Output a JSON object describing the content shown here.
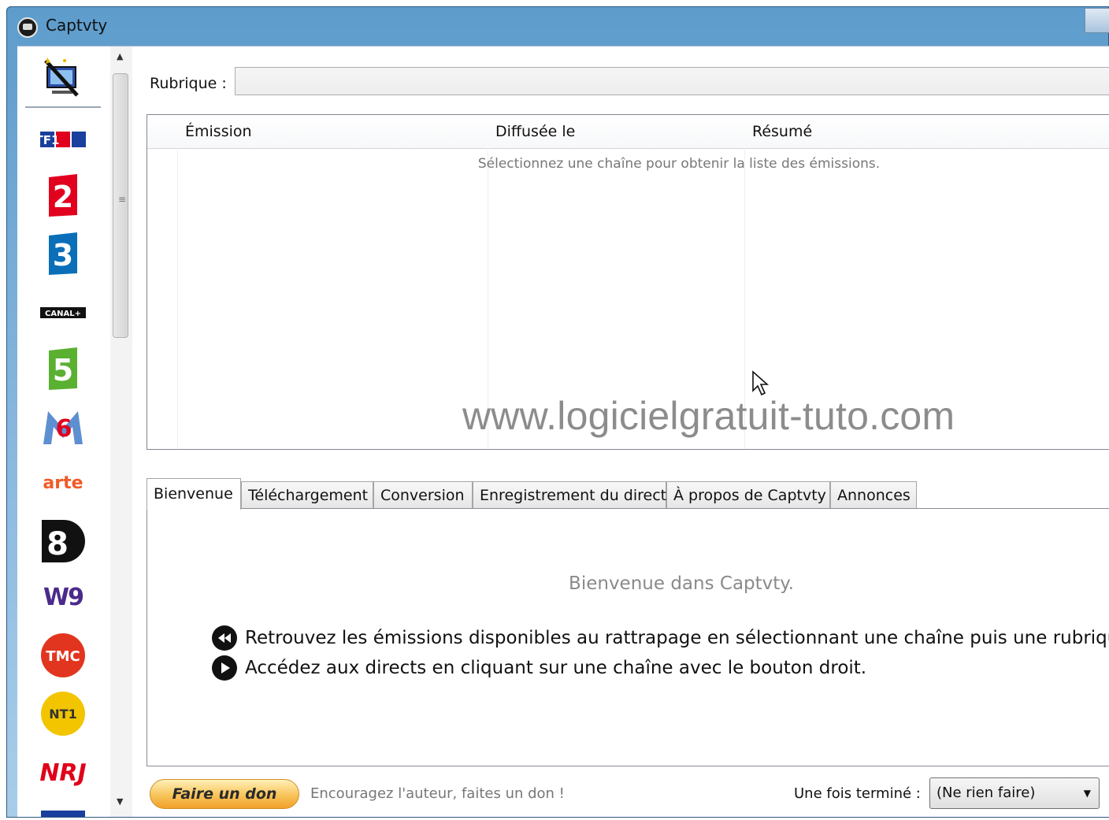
{
  "window": {
    "title": "Captvty"
  },
  "channels": [
    {
      "id": "tools",
      "label": ""
    },
    {
      "id": "tf1",
      "label": "TF1"
    },
    {
      "id": "france2",
      "label": "2"
    },
    {
      "id": "france3",
      "label": "3"
    },
    {
      "id": "canalplus",
      "label": "CANAL+"
    },
    {
      "id": "france5",
      "label": "5"
    },
    {
      "id": "m6",
      "label": "6"
    },
    {
      "id": "arte",
      "label": "arte"
    },
    {
      "id": "d8",
      "label": "8"
    },
    {
      "id": "w9",
      "label": "W9"
    },
    {
      "id": "tmc",
      "label": "TMC"
    },
    {
      "id": "nt1",
      "label": "NT1"
    },
    {
      "id": "nrj12",
      "label": "NRJ"
    }
  ],
  "main": {
    "rubrique_label": "Rubrique :",
    "columns": [
      "Émission",
      "Diffusée le",
      "Résumé"
    ],
    "empty_message": "Sélectionnez une chaîne pour obtenir la liste des émissions.",
    "watermark": "www.logicielgratuit-tuto.com"
  },
  "tabs": [
    {
      "label": "Bienvenue",
      "active": true
    },
    {
      "label": "Téléchargement",
      "active": false
    },
    {
      "label": "Conversion",
      "active": false
    },
    {
      "label": "Enregistrement du direct",
      "active": false
    },
    {
      "label": "À propos de Captvty",
      "active": false
    },
    {
      "label": "Annonces",
      "active": false
    }
  ],
  "welcome": {
    "title": "Bienvenue dans Captvty.",
    "lines": [
      {
        "icon": "rewind-icon",
        "text": "Retrouvez les émissions disponibles au rattrapage en sélectionnant une chaîne puis une rubrique."
      },
      {
        "icon": "play-icon",
        "text": "Accédez aux directs en cliquant sur une chaîne avec le bouton droit."
      }
    ]
  },
  "footer": {
    "donate_label": "Faire un don",
    "donate_text": "Encouragez l'auteur, faites un don !",
    "finish_label": "Une fois terminé :",
    "finish_value": "(Ne rien faire)"
  },
  "colors": {
    "title_bar": "#5d9ccc",
    "donate_button": "#f8c35a",
    "tf1_blue": "#1a3f9c",
    "france2_red": "#e1001e",
    "france3_blue": "#0a6fb8",
    "france5_green": "#5ab031",
    "arte_orange": "#f05a28",
    "w9_purple": "#4b2a8a",
    "tmc_red": "#e2351f",
    "nt1_yellow": "#f2c500",
    "nrj_red": "#e0001a"
  }
}
